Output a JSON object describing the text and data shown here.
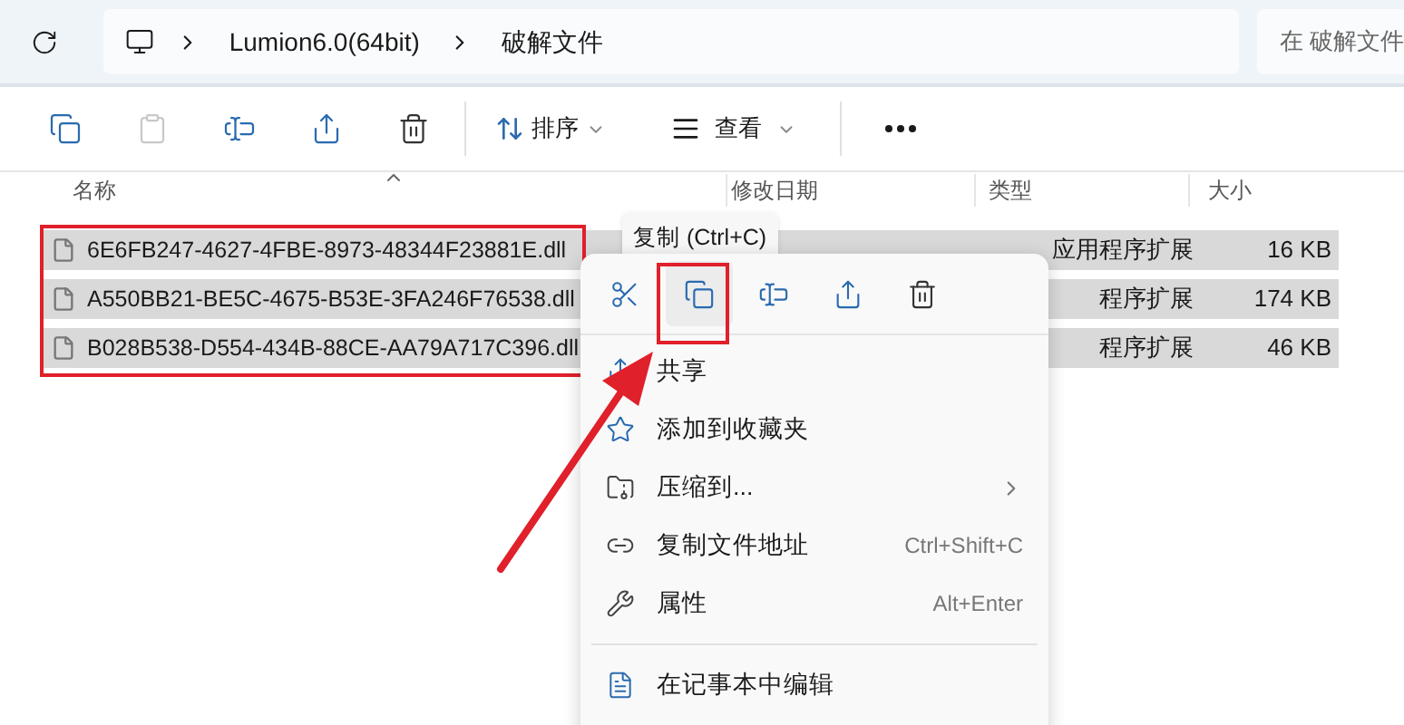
{
  "address_bar": {
    "path": [
      "Lumion6.0(64bit)",
      "破解文件"
    ]
  },
  "search": {
    "placeholder": "在 破解文件"
  },
  "toolbar": {
    "buttons": [
      {
        "kind": "copy",
        "disabled": false
      },
      {
        "kind": "paste",
        "disabled": true
      },
      {
        "kind": "rename",
        "disabled": false
      },
      {
        "kind": "share",
        "disabled": false
      },
      {
        "kind": "delete",
        "disabled": false
      }
    ],
    "sort": "排序",
    "view": "查看"
  },
  "columns": [
    "名称",
    "修改日期",
    "类型",
    "大小"
  ],
  "files": [
    {
      "name": "6E6FB247-4627-4FBE-8973-48344F23881E.dll",
      "type": "应用程序扩展",
      "size": "16 KB",
      "selected": true
    },
    {
      "name": "A550BB21-BE5C-4675-B53E-3FA246F76538.dll",
      "type": "程序扩展",
      "size": "174 KB",
      "selected": true
    },
    {
      "name": "B028B538-D554-434B-88CE-AA79A717C396.dll",
      "type": "程序扩展",
      "size": "46 KB",
      "selected": true
    }
  ],
  "tooltip": "复制 (Ctrl+C)",
  "context_menu": {
    "actions": [
      {
        "kind": "cut",
        "selected": false
      },
      {
        "kind": "copy",
        "selected": true
      },
      {
        "kind": "rename",
        "selected": false
      },
      {
        "kind": "share",
        "selected": false
      },
      {
        "kind": "delete",
        "selected": false
      }
    ],
    "items": [
      {
        "kind": "share",
        "label": "共享"
      },
      {
        "kind": "favorite",
        "label": "添加到收藏夹"
      },
      {
        "kind": "compress",
        "label": "压缩到...",
        "submenu": true
      },
      {
        "kind": "copy-path",
        "label": "复制文件地址",
        "shortcut": "Ctrl+Shift+C"
      },
      {
        "kind": "properties",
        "label": "属性",
        "shortcut": "Alt+Enter"
      },
      {
        "kind": "separator"
      },
      {
        "kind": "notepad",
        "label": "在记事本中编辑"
      }
    ]
  }
}
